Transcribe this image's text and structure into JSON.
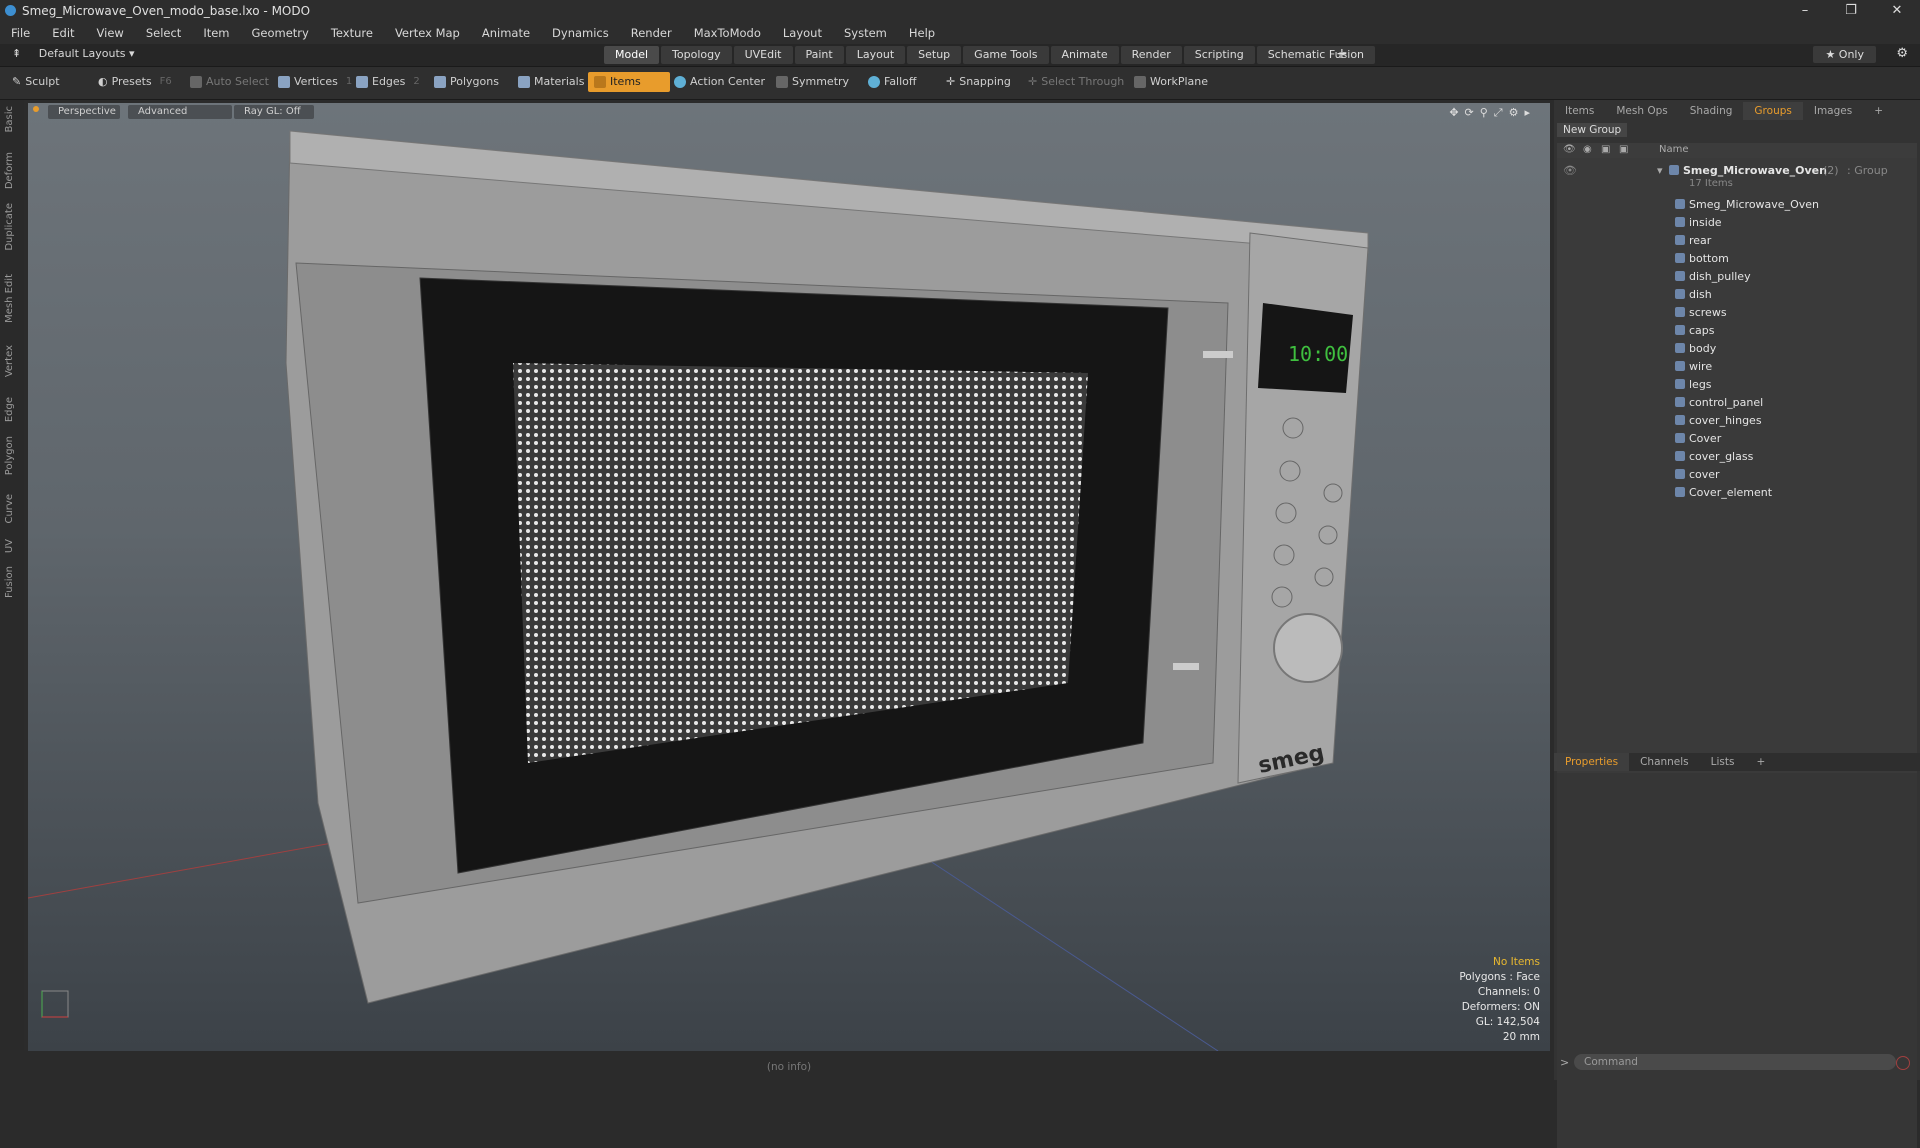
{
  "window": {
    "title": "Smeg_Microwave_Oven_modo_base.lxo - MODO",
    "minimize": "–",
    "maximize": "❐",
    "close": "✕"
  },
  "menu": [
    "File",
    "Edit",
    "View",
    "Select",
    "Item",
    "Geometry",
    "Texture",
    "Vertex Map",
    "Animate",
    "Dynamics",
    "Render",
    "MaxToModo",
    "Layout",
    "System",
    "Help"
  ],
  "layouts": {
    "label": "Default Layouts ▾"
  },
  "mode_tabs": [
    "Model",
    "Topology",
    "UVEdit",
    "Paint",
    "Layout",
    "Setup",
    "Game Tools",
    "Animate",
    "Render",
    "Scripting",
    "Schematic Fusion"
  ],
  "mode_tabs_active": 0,
  "add_tab": "+",
  "only_label": "★ Only",
  "toolbar": {
    "sculpt": "Sculpt",
    "presets": "Presets",
    "presets_key": "F6",
    "auto_select": "Auto Select",
    "vertices": "Vertices",
    "vertices_num": "1",
    "edges": "Edges",
    "edges_num": "2",
    "polygons": "Polygons",
    "materials": "Materials",
    "items": "Items",
    "action_center": "Action Center",
    "symmetry": "Symmetry",
    "falloff": "Falloff",
    "snapping": "Snapping",
    "select_through": "Select Through",
    "workplane": "WorkPlane"
  },
  "left_tabs": [
    "Basic",
    "Deform",
    "Duplicate",
    "Mesh Edit",
    "Vertex",
    "Edge",
    "Polygon",
    "Curve",
    "UV",
    "Fusion"
  ],
  "viewport": {
    "view": "Perspective",
    "shading": "Advanced",
    "raygl": "Ray GL: Off",
    "clock": "10:00",
    "brand": "smeg",
    "info": {
      "selection": "No Items",
      "polygons": "Polygons : Face",
      "channels": "Channels: 0",
      "deformers": "Deformers: ON",
      "gl": "GL: 142,504",
      "scale": "20 mm"
    }
  },
  "status": "(no info)",
  "right_tabs": [
    "Items",
    "Mesh Ops",
    "Shading",
    "Groups",
    "Images",
    "+"
  ],
  "right_tabs_active": 3,
  "new_group": "New Group",
  "tree_header": "Name",
  "group": {
    "name": "Smeg_Microwave_Oven",
    "count": "(2)",
    "type": ": Group",
    "items_label": "17 Items"
  },
  "items": [
    "Smeg_Microwave_Oven",
    "inside",
    "rear",
    "bottom",
    "dish_pulley",
    "dish",
    "screws",
    "caps",
    "body",
    "wire",
    "legs",
    "control_panel",
    "cover_hinges",
    "Cover",
    "cover_glass",
    "cover",
    "Cover_element"
  ],
  "prop_tabs": [
    "Properties",
    "Channels",
    "Lists",
    "+"
  ],
  "prop_tabs_active": 0,
  "command_placeholder": "Command"
}
